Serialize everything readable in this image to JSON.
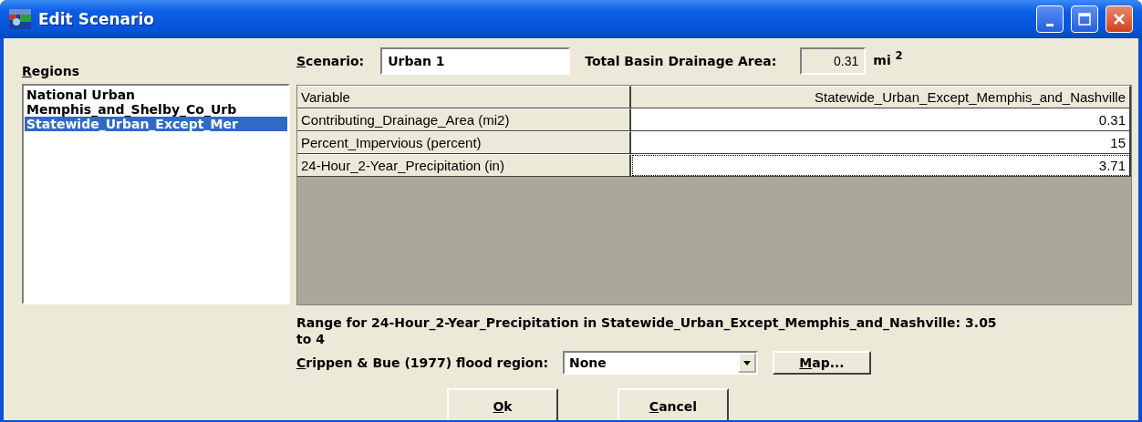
{
  "window": {
    "title": "Edit Scenario"
  },
  "regions": {
    "label": "Regions",
    "items": [
      {
        "label": "National Urban",
        "selected": false
      },
      {
        "label": "Memphis_and_Shelby_Co_Urb",
        "selected": false
      },
      {
        "label": "Statewide_Urban_Except_Mer",
        "selected": true
      }
    ]
  },
  "scenario": {
    "label": "Scenario:",
    "value": "Urban 1"
  },
  "drainage_area": {
    "label": "Total Basin Drainage Area:",
    "value": "0.31",
    "unit": "mi $^{2}$"
  },
  "table": {
    "columns": [
      "Variable",
      "Statewide_Urban_Except_Memphis_and_Nashville"
    ],
    "rows": [
      {
        "cells": [
          "Contributing_Drainage_Area (mi2)",
          "0.31"
        ],
        "focused": false
      },
      {
        "cells": [
          "Percent_Impervious (percent)",
          "15"
        ],
        "focused": false
      },
      {
        "cells": [
          "24-Hour_2-Year_Precipitation (in)",
          "3.71"
        ],
        "focused": true
      }
    ]
  },
  "range_text": "Range for 24-Hour_2-Year_Precipitation in Statewide_Urban_Except_Memphis_and_Nashville: 3.05 to 4",
  "flood_region": {
    "label": "Crippen & Bue (1977) flood region:",
    "value": "None"
  },
  "map_button": "Map...",
  "buttons": [
    "Ok",
    "Cancel"
  ]
}
